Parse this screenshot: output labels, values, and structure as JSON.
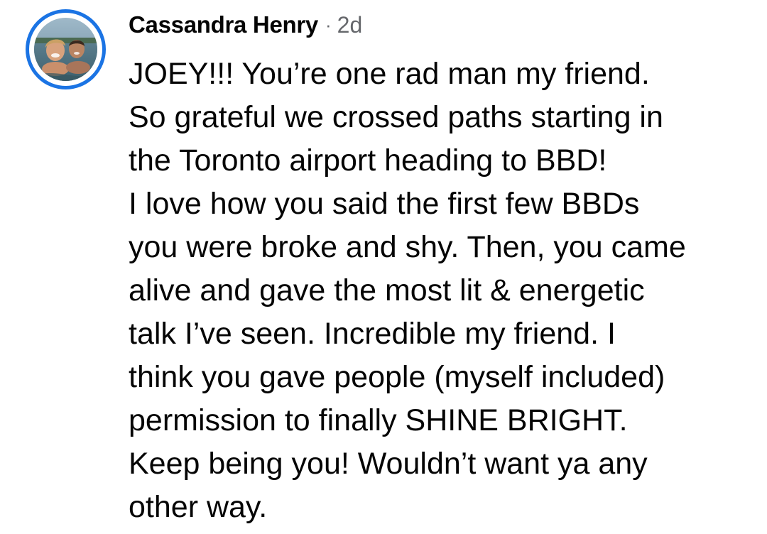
{
  "comment": {
    "author": "Cassandra Henry",
    "separator": "·",
    "timestamp": "2d",
    "avatar": {
      "icon": "profile-photo",
      "ring_color": "#1b74e4"
    },
    "body_lines": [
      "JOEY!!! You’re one rad man my friend.",
      "So grateful we crossed paths starting in",
      "the Toronto airport heading to BBD!",
      "I love how you said the first few BBDs",
      "you were broke and shy. Then, you came",
      "alive and gave the most lit & energetic",
      "talk I’ve seen. Incredible my friend. I",
      "think you gave people (myself included)",
      "permission to finally SHINE BRIGHT.",
      "Keep being you! Wouldn’t want ya any",
      "other way."
    ]
  },
  "colors": {
    "text": "#050505",
    "secondary_text": "#65676b",
    "accent": "#1b74e4",
    "background": "#ffffff"
  }
}
